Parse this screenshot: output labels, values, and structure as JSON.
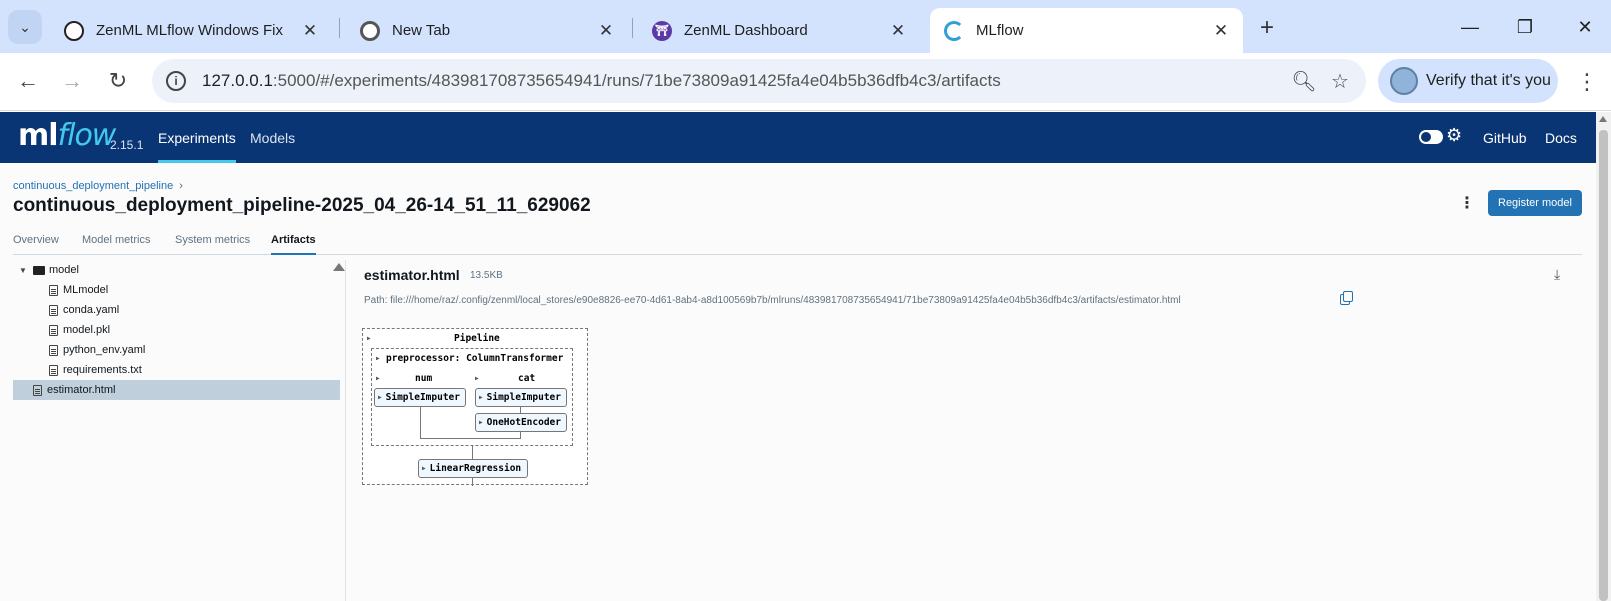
{
  "browser": {
    "tabs": [
      {
        "title": "ZenML MLflow Windows Fix",
        "icon": "openai-icon"
      },
      {
        "title": "New Tab",
        "icon": "chrome-icon"
      },
      {
        "title": "ZenML Dashboard",
        "icon": "zenml-icon"
      },
      {
        "title": "MLflow",
        "icon": "loading-icon"
      }
    ],
    "url_host": "127.0.0.1",
    "url_path": ":5000/#/experiments/483981708735654941/runs/71be73809a91425fa4e04b5b36dfb4c3/artifacts",
    "profile_label": "Verify that it's you"
  },
  "mlflow": {
    "logo_ml": "ml",
    "logo_flow": "flow",
    "version": "2.15.1",
    "nav": [
      "Experiments",
      "Models"
    ],
    "links": [
      "GitHub",
      "Docs"
    ]
  },
  "page": {
    "breadcrumb": "continuous_deployment_pipeline",
    "breadcrumb_sep": "›",
    "title": "continuous_deployment_pipeline-2025_04_26-14_51_11_629062",
    "register_label": "Register model",
    "more_label": "⋮",
    "tabs": [
      "Overview",
      "Model metrics",
      "System metrics",
      "Artifacts"
    ],
    "active_tab": "Artifacts"
  },
  "tree": {
    "folder": "model",
    "files": [
      "MLmodel",
      "conda.yaml",
      "model.pkl",
      "python_env.yaml",
      "requirements.txt"
    ],
    "selected": "estimator.html"
  },
  "viewer": {
    "filename": "estimator.html",
    "size": "13.5KB",
    "path": "Path: file:///home/raz/.config/zenml/local_stores/e90e8826-ee70-4d61-8ab4-a8d100569b7b/mlruns/483981708735654941/71be73809a91425fa4e04b5b36dfb4c3/artifacts/estimator.html",
    "diagram": {
      "pipeline": "Pipeline",
      "preprocessor": "preprocessor: ColumnTransformer",
      "num": "num",
      "cat": "cat",
      "num_imputer": "SimpleImputer",
      "cat_imputer": "SimpleImputer",
      "encoder": "OneHotEncoder",
      "regressor": "LinearRegression"
    }
  },
  "colors": {
    "header_bg": "#0a3574",
    "accent": "#2272b4",
    "selected_row": "#c0cfdc"
  }
}
